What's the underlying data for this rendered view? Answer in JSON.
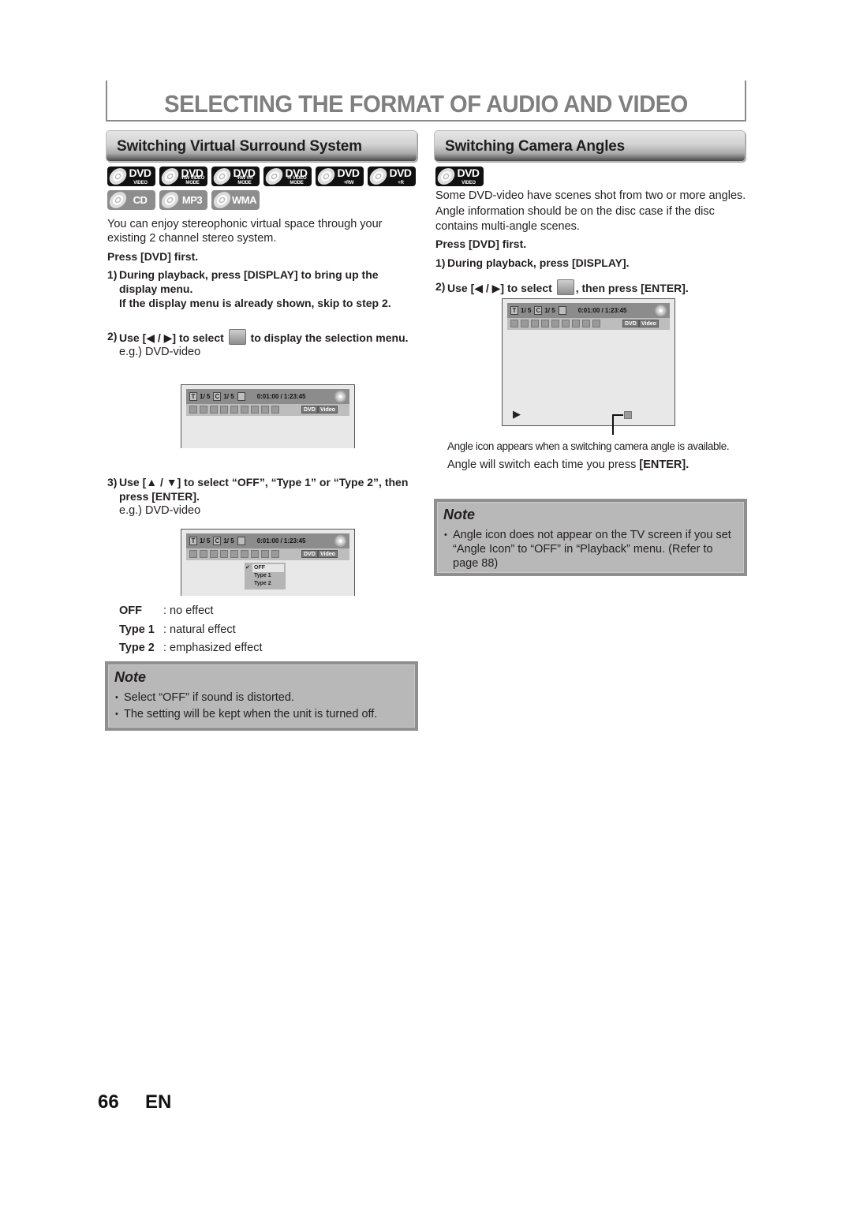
{
  "page": {
    "title": "SELECTING THE FORMAT OF AUDIO AND VIDEO",
    "page_number": "66",
    "language": "EN"
  },
  "left": {
    "header": "Switching Virtual Surround System",
    "discs": [
      {
        "label": "DVD",
        "sub": "VIDEO",
        "style": "black"
      },
      {
        "label": "DVD",
        "sub": "-RW VIDEO MODE",
        "style": "black"
      },
      {
        "label": "DVD",
        "sub": "-RW VR MODE",
        "style": "black"
      },
      {
        "label": "DVD",
        "sub": "-R VIDEO MODE",
        "style": "black"
      },
      {
        "label": "DVD",
        "sub": "+RW",
        "style": "black"
      },
      {
        "label": "DVD",
        "sub": "+R",
        "style": "black"
      },
      {
        "label": "CD",
        "sub": "",
        "style": "grey"
      },
      {
        "label": "MP3",
        "sub": "",
        "style": "grey"
      },
      {
        "label": "WMA",
        "sub": "",
        "style": "grey"
      }
    ],
    "intro": "You can enjoy stereophonic virtual space through your existing 2 channel stereo system.",
    "press_first": "Press [DVD] first.",
    "step1_num": "1)",
    "step1": "During playback, press [DISPLAY] to bring up the display menu.",
    "step1_sub": "If the display menu is already shown, skip to step 2.",
    "step2_num": "2)",
    "step2_a": "Use [◀ / ▶] to select",
    "step2_icon": "virtual-surround-icon",
    "step2_b": "to display the selection menu.",
    "step2_eg": "e.g.) DVD-video",
    "step3_num": "3)",
    "step3": "Use [▲ / ▼] to select “OFF”, “Type 1” or “Type 2”, then press [ENTER].",
    "step3_eg": "e.g.) DVD-video",
    "options": [
      {
        "key": "OFF",
        "value": ": no effect"
      },
      {
        "key": "Type 1",
        "value": ": natural effect"
      },
      {
        "key": "Type 2",
        "value": ": emphasized effect"
      }
    ],
    "note_title": "Note",
    "notes": [
      "Select “OFF” if sound is distorted.",
      "The setting will be kept when the unit is turned off."
    ]
  },
  "osd": {
    "title_box": "T",
    "title_val": "1/ 5",
    "chapter_box": "C",
    "chapter_val": "1/ 5",
    "time": "0:01:00 / 1:23:45",
    "tag_dvd": "DVD",
    "tag_video": "Video",
    "menu_options": [
      "OFF",
      "Type 1",
      "Type 2"
    ],
    "menu_selected": "OFF",
    "check": "✔",
    "play_symbol": "▶"
  },
  "right": {
    "header": "Switching Camera Angles",
    "disc": {
      "label": "DVD",
      "sub": "VIDEO"
    },
    "intro": "Some DVD-video have scenes shot from two or more angles. Angle information should be on the disc case if the disc contains multi-angle scenes.",
    "press_first": "Press [DVD] first.",
    "step1_num": "1)",
    "step1": "During playback, press [DISPLAY].",
    "step2_num": "2)",
    "step2_a": "Use [◀ / ▶] to select",
    "step2_icon": "camera-angle-icon",
    "step2_b": ", then press [ENTER].",
    "caption": "Angle icon appears when a switching camera angle is available.",
    "switch_text": "Angle will switch each time you press ",
    "switch_key": "[ENTER].",
    "note_title": "Note",
    "notes": [
      "Angle icon does not appear on the TV screen if you set “Angle Icon” to “OFF” in “Playback” menu. (Refer to page 88)"
    ]
  }
}
